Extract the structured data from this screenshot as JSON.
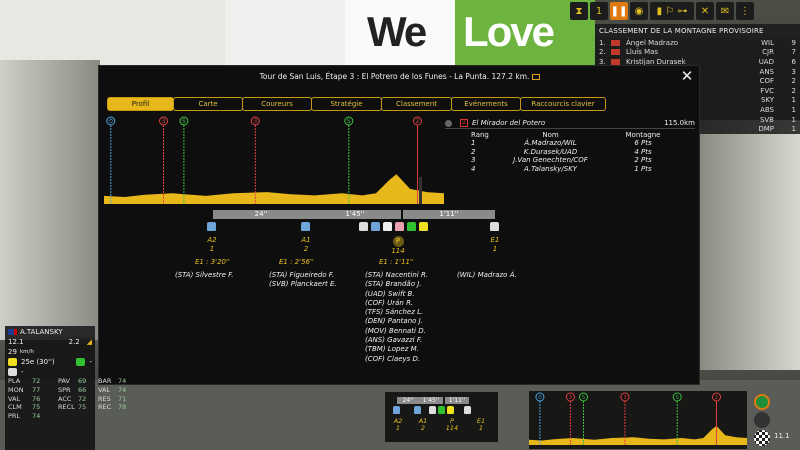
{
  "background": {
    "banner_we": "We",
    "banner_love": "Love"
  },
  "mountain_panel": {
    "title": "CLASSEMENT DE LA MONTAGNE PROVISOIRE",
    "rows": [
      {
        "pos": "1.",
        "name": "Ángel Madrazo",
        "team": "WIL",
        "pts": "9"
      },
      {
        "pos": "2.",
        "name": "Lluís Mas",
        "team": "CJR",
        "pts": "7"
      },
      {
        "pos": "3.",
        "name": "Kristijan Durasek",
        "team": "UAD",
        "pts": "6"
      },
      {
        "pos": "",
        "name": "",
        "team": "ANS",
        "pts": "3"
      },
      {
        "pos": "",
        "name": "",
        "team": "COF",
        "pts": "2"
      },
      {
        "pos": "",
        "name": "",
        "team": "FVC",
        "pts": "2"
      },
      {
        "pos": "",
        "name": "",
        "team": "SKY",
        "pts": "1"
      },
      {
        "pos": "",
        "name": "",
        "team": "ABS",
        "pts": "1"
      },
      {
        "pos": "",
        "name": "",
        "team": "SVB",
        "pts": "1"
      },
      {
        "pos": "",
        "name": "",
        "team": "DMP",
        "pts": "1"
      }
    ]
  },
  "dialog": {
    "title": "Tour de San Luis, Étape 3 : El Potrero de los Funes - La Punta. 127.2 km.",
    "close": "✕",
    "tabs": [
      {
        "label": "Profil",
        "active": true
      },
      {
        "label": "Carte"
      },
      {
        "label": "Coureurs"
      },
      {
        "label": "Stratégie"
      },
      {
        "label": "Classement"
      },
      {
        "label": "Evénements"
      },
      {
        "label": "Raccourcis clavier"
      }
    ],
    "markers": [
      {
        "label": "⏱",
        "color": "#4aa3e0"
      },
      {
        "label": "3",
        "color": "#e04040"
      },
      {
        "label": "S",
        "color": "#40c040"
      },
      {
        "label": "3",
        "color": "#e04040"
      },
      {
        "label": "S",
        "color": "#40c040"
      },
      {
        "label": "2",
        "color": "#e04040"
      }
    ],
    "summit": {
      "badge": "2",
      "name": "El Mirador del Potero",
      "km": "115.0km",
      "headers": {
        "rank": "Rang",
        "name": "Nom",
        "pts": "Montagne"
      },
      "rows": [
        {
          "rank": "1",
          "name": "Á.Madrazo/WIL",
          "pts": "6 Pts"
        },
        {
          "rank": "2",
          "name": "K.Durasek/UAD",
          "pts": "4 Pts"
        },
        {
          "rank": "3",
          "name": "J.Van Genechten/COF",
          "pts": "2 Pts"
        },
        {
          "rank": "4",
          "name": "A.Talansky/SKY",
          "pts": "1 Pts"
        }
      ]
    },
    "gaps": [
      "24''",
      "1'45''",
      "1'11''"
    ],
    "groups": [
      {
        "code": "A2",
        "count": "1",
        "time": "E1 : 3'20''",
        "riders": [
          "(STA) Silvestre F."
        ]
      },
      {
        "code": "A1",
        "count": "2",
        "time": "E1 : 2'56''",
        "riders": [
          "(STA) Figueiredo F.",
          "(SVB) Planckaert E."
        ]
      },
      {
        "code": "P",
        "count": "114",
        "time": "E1 : 1'11''",
        "riders": [
          "(STA) Nacentini R.",
          "(STA) Brandão J.",
          "(UAD) Swift B.",
          "(COF) Urán R.",
          "(TFS) Sánchez L.",
          "(DEN) Pantano J.",
          "(MOV) Bennati D.",
          "(ANS) Gavazzi F.",
          "(TBM) Lopez M.",
          "(COF) Claeys D."
        ]
      },
      {
        "code": "E1",
        "count": "1",
        "time": "",
        "riders": [
          "(WIL) Madrazo Á."
        ]
      }
    ]
  },
  "rider_card": {
    "name": "A.TALANSKY",
    "speed": "12.1",
    "speed_unit": "km/h",
    "distance": "29",
    "val2": "2.2",
    "position": "25e (30'')",
    "dash": "-",
    "stats": [
      {
        "k": "PLA",
        "v": "72"
      },
      {
        "k": "PAV",
        "v": "69"
      },
      {
        "k": "BAR",
        "v": "74"
      },
      {
        "k": "MON",
        "v": "77"
      },
      {
        "k": "SPR",
        "v": "66"
      },
      {
        "k": "VAL",
        "v": "74"
      },
      {
        "k": "VAL",
        "v": "76"
      },
      {
        "k": "ACC",
        "v": "72"
      },
      {
        "k": "RES",
        "v": "71"
      },
      {
        "k": "CLM",
        "v": "75"
      },
      {
        "k": "RECL",
        "v": "75"
      },
      {
        "k": "REC",
        "v": "78"
      },
      {
        "k": "PRL",
        "v": "74"
      }
    ]
  },
  "mini_groups": {
    "gaps": [
      "24''",
      "1'45''",
      "1'11''"
    ],
    "labels": [
      {
        "code": "A2",
        "count": "1"
      },
      {
        "code": "A1",
        "count": "2"
      },
      {
        "code": "P",
        "count": "114"
      },
      {
        "code": "E1",
        "count": "1"
      }
    ]
  },
  "speed_readout": "11.1",
  "colors": {
    "accent": "#e8b81a",
    "profile_fill": "#e8b81a",
    "red": "#e04040",
    "green": "#40c040"
  }
}
